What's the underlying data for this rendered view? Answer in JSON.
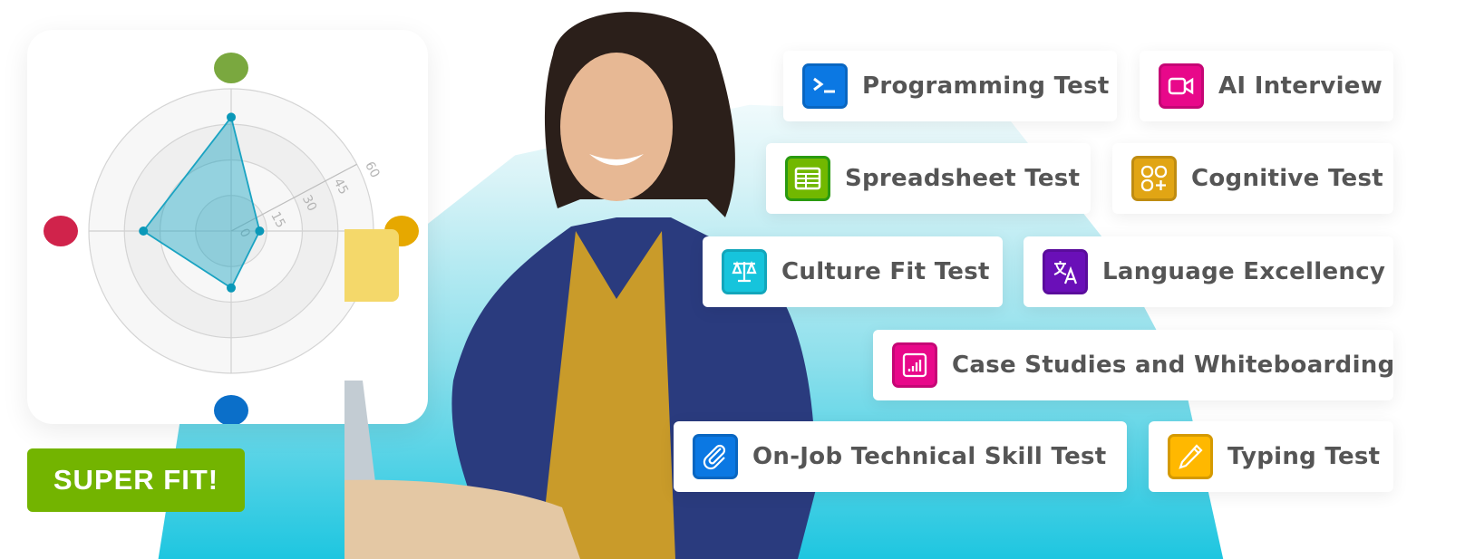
{
  "badge": {
    "label": "SUPER FIT!",
    "color": "#73b400"
  },
  "tests": [
    {
      "label": "Programming Test",
      "icon": "terminal-icon",
      "color": "#0b78e3"
    },
    {
      "label": "AI Interview",
      "icon": "video-camera-icon",
      "color": "#e8088a"
    },
    {
      "label": "Spreadsheet Test",
      "icon": "spreadsheet-icon",
      "color": "#72b800"
    },
    {
      "label": "Cognitive Test",
      "icon": "shapes-plus-icon",
      "color": "#e1a514"
    },
    {
      "label": "Culture Fit Test",
      "icon": "scales-icon",
      "color": "#16c4dc"
    },
    {
      "label": "Language Excellency",
      "icon": "translate-icon",
      "color": "#6a0fb8"
    },
    {
      "label": "Case Studies and Whiteboarding",
      "icon": "bar-chart-board-icon",
      "color": "#e8088a"
    },
    {
      "label": "On-Job Technical Skill Test",
      "icon": "paperclip-icon",
      "color": "#0b78e3"
    },
    {
      "label": "Typing Test",
      "icon": "pencil-icon",
      "color": "#ffb800"
    }
  ],
  "chart_data": {
    "type": "radar",
    "title": "",
    "axes": [
      {
        "name": "top",
        "color": "#7aa83f",
        "value": 48
      },
      {
        "name": "right",
        "color": "#e6a800",
        "value": 12
      },
      {
        "name": "bottom",
        "color": "#0b6fc9",
        "value": 24
      },
      {
        "name": "left",
        "color": "#d0234b",
        "value": 37
      }
    ],
    "rlim": [
      0,
      60
    ],
    "r_ticks": [
      "0",
      "15",
      "30",
      "45",
      "60"
    ],
    "series_color": "#1aa3c2",
    "grid": true
  }
}
